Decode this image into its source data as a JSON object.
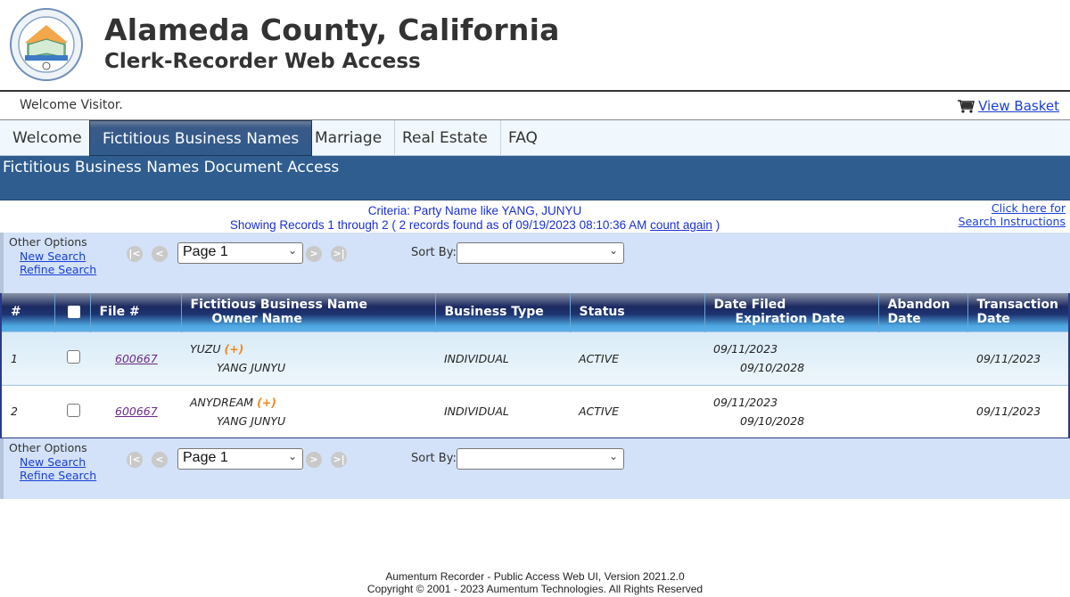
{
  "header": {
    "title": "Alameda County, California",
    "subtitle": "Clerk-Recorder Web Access",
    "logo": "county-seal-icon"
  },
  "welcome_bar": {
    "greeting": "Welcome Visitor.",
    "basket_label": "View Basket",
    "basket_icon": "shopping-cart-icon"
  },
  "tabs": [
    {
      "label": "Welcome",
      "active": false
    },
    {
      "label": "Fictitious Business Names",
      "active": true
    },
    {
      "label": "Marriage",
      "active": false
    },
    {
      "label": "Real Estate",
      "active": false
    },
    {
      "label": "FAQ",
      "active": false
    }
  ],
  "section_title": "Fictitious Business Names Document Access",
  "criteria": {
    "line1": "Criteria:  Party Name like YANG, JUNYU",
    "line2_prefix": "Showing Records 1 through 2 ( 2 records found as of 09/19/2023 08:10:36 AM ",
    "count_again": "count again",
    "line2_suffix": " )"
  },
  "instructions": {
    "line1": "Click here for",
    "line2": "Search Instructions"
  },
  "pager": {
    "other_options": "Other Options",
    "new_search": "New Search",
    "refine_search": "Refine Search",
    "page_value": "Page 1",
    "sort_by_label": "Sort By:",
    "sort_by_value": "",
    "first_icon": "first-page-icon",
    "prev_icon": "previous-page-icon",
    "next_icon": "next-page-icon",
    "last_icon": "last-page-icon"
  },
  "table": {
    "columns": {
      "num": "#",
      "file": "File #",
      "name_line1": "Fictitious Business Name",
      "name_line2": "Owner Name",
      "type": "Business Type",
      "status": "Status",
      "date_line1": "Date Filed",
      "date_line2": "Expiration Date",
      "abandon_line1": "Abandon",
      "abandon_line2": "Date",
      "trans_line1": "Transaction",
      "trans_line2": "Date"
    },
    "rows": [
      {
        "num": "1",
        "file": "600667",
        "business_name": "YUZU",
        "plus": "(+)",
        "owner": "YANG JUNYU",
        "type": "INDIVIDUAL",
        "status": "ACTIVE",
        "date_filed": "09/11/2023",
        "expiration": "09/10/2028",
        "abandon": "",
        "transaction": "09/11/2023"
      },
      {
        "num": "2",
        "file": "600667",
        "business_name": "ANYDREAM",
        "plus": "(+)",
        "owner": "YANG JUNYU",
        "type": "INDIVIDUAL",
        "status": "ACTIVE",
        "date_filed": "09/11/2023",
        "expiration": "09/10/2028",
        "abandon": "",
        "transaction": "09/11/2023"
      }
    ]
  },
  "footer": {
    "line1": "Aumentum Recorder - Public Access Web UI, Version 2021.2.0",
    "line2": "Copyright © 2001 - 2023  Aumentum Technologies. All Rights Reserved"
  }
}
